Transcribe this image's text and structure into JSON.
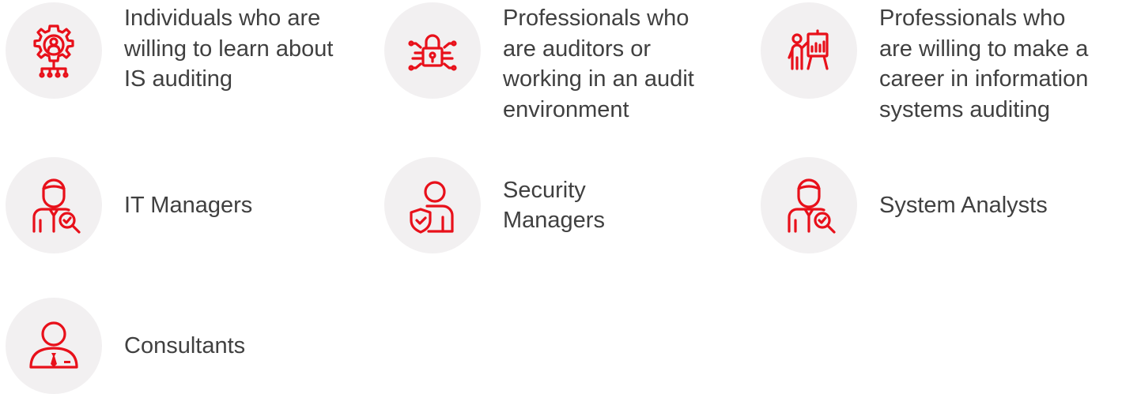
{
  "accent_color": "#e8101a",
  "icon_bg_color": "#f2f0f1",
  "audience": [
    {
      "icon": "gear-person-network-icon",
      "label": "Individuals who are\nwilling to learn about\nIS auditing"
    },
    {
      "icon": "padlock-circuit-icon",
      "label": "Professionals who\nare auditors or\nworking in an audit\nenvironment"
    },
    {
      "icon": "presenter-chart-icon",
      "label": "Professionals who\nare willing to make a\ncareer in information\nsystems auditing"
    },
    {
      "icon": "manager-magnifier-icon",
      "label": "IT Managers"
    },
    {
      "icon": "person-shield-icon",
      "label": "Security\nManagers"
    },
    {
      "icon": "manager-magnifier-icon",
      "label": "System Analysts"
    },
    {
      "icon": "consultant-icon",
      "label": "Consultants"
    }
  ]
}
